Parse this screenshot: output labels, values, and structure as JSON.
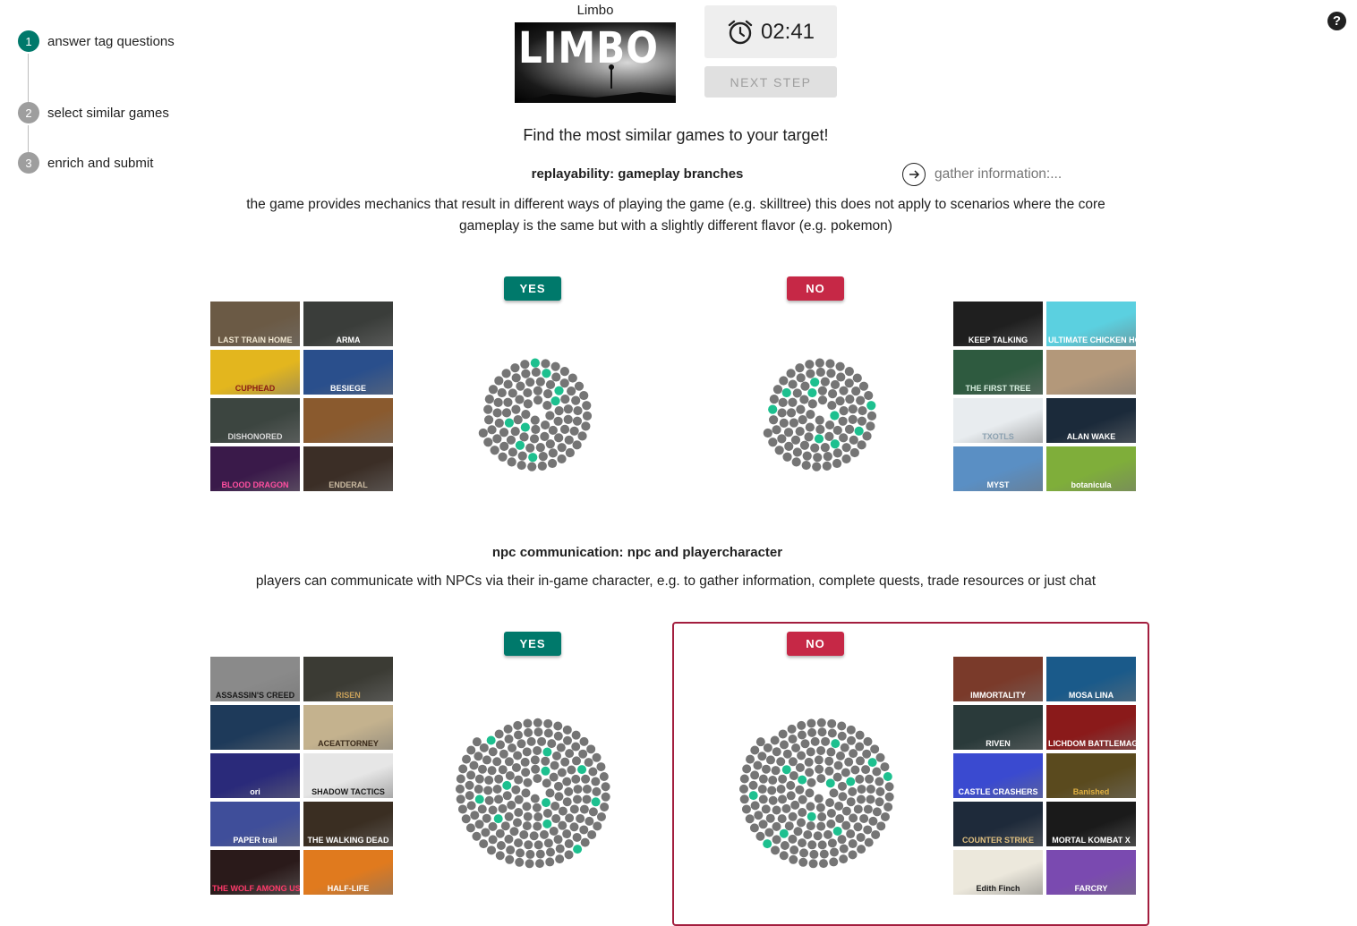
{
  "stepper": {
    "steps": [
      {
        "number": "1",
        "label": "answer tag questions"
      },
      {
        "number": "2",
        "label": "select similar games"
      },
      {
        "number": "3",
        "label": "enrich and submit"
      }
    ]
  },
  "help": {
    "icon": "question-icon",
    "glyph": "?"
  },
  "target": {
    "title": "Limbo",
    "cover_text": "LIMBO"
  },
  "timer": {
    "icon": "alarm-clock-icon",
    "value": "02:41"
  },
  "next_step": {
    "label": "NEXT STEP"
  },
  "headline": "Find the most similar games to your target!",
  "gather": {
    "icon": "arrow-right-circle-icon",
    "placeholder": "gather information:..."
  },
  "colors": {
    "yes": "#00796b",
    "no": "#c62846",
    "dot": "#757575",
    "dot_highlight": "#1dc08f"
  },
  "questions": [
    {
      "title": "replayability: gameplay branches",
      "description": "the game provides mechanics that result in different ways of playing the game (e.g. skilltree) this does not apply to scenarios where the core gameplay is the same but with a slightly different flavor (e.g. pokemon)",
      "yes_label": "YES",
      "no_label": "NO",
      "selected": "",
      "yes_games": [
        {
          "label": "LAST TRAIN HOME",
          "bg": "#6b5a45",
          "fg": "#f0e6d0"
        },
        {
          "label": "ARMA",
          "bg": "#3a3d3a",
          "fg": "#ffffff"
        },
        {
          "label": "CUPHEAD",
          "bg": "#e3b61e",
          "fg": "#8b1b12"
        },
        {
          "label": "BESIEGE",
          "bg": "#2a4f8c",
          "fg": "#ffffff"
        },
        {
          "label": "DISHONORED",
          "bg": "#3c4540",
          "fg": "#d8d8d8"
        },
        {
          "label": "",
          "bg": "#8a5a2e",
          "fg": "#ffffff"
        },
        {
          "label": "BLOOD DRAGON",
          "bg": "#3a1a4a",
          "fg": "#ff4fa0"
        },
        {
          "label": "ENDERAL",
          "bg": "#3b2e26",
          "fg": "#c9b9a0"
        }
      ],
      "no_games": [
        {
          "label": "KEEP TALKING",
          "bg": "#1f1f1f",
          "fg": "#ffffff"
        },
        {
          "label": "ULTIMATE CHICKEN HORSE",
          "bg": "#5bd0e0",
          "fg": "#ffffff"
        },
        {
          "label": "THE FIRST TREE",
          "bg": "#2e5a3f",
          "fg": "#d8efe0"
        },
        {
          "label": "",
          "bg": "#b3987a",
          "fg": "#3a2a1a"
        },
        {
          "label": "TXOTLS",
          "bg": "#e8ecef",
          "fg": "#8aa0b0"
        },
        {
          "label": "ALAN WAKE",
          "bg": "#1b2a3a",
          "fg": "#ffffff"
        },
        {
          "label": "MYST",
          "bg": "#5a8fc4",
          "fg": "#ffffff"
        },
        {
          "label": "botanicula",
          "bg": "#7fae3a",
          "fg": "#ffffff"
        }
      ],
      "yes_spiral": {
        "dots": 100,
        "highlights": [
          8,
          15,
          23,
          31,
          40,
          51,
          63,
          77
        ]
      },
      "no_spiral": {
        "dots": 100,
        "highlights": [
          5,
          12,
          20,
          28,
          37,
          46,
          58,
          70,
          84
        ]
      }
    },
    {
      "title": "npc communication: npc and playercharacter",
      "description": "players can communicate with NPCs via their in-game character, e.g. to gather information, complete quests, trade resources or just chat",
      "yes_label": "YES",
      "no_label": "NO",
      "selected": "no",
      "yes_games": [
        {
          "label": "ASSASSIN'S CREED",
          "bg": "#8a8a8a",
          "fg": "#1a1a1a"
        },
        {
          "label": "RISEN",
          "bg": "#3b3b34",
          "fg": "#c9a15a"
        },
        {
          "label": "",
          "bg": "#1e3a5a",
          "fg": "#ff8040"
        },
        {
          "label": "ACEATTORNEY",
          "bg": "#c4b28e",
          "fg": "#3a2a1a"
        },
        {
          "label": "ori",
          "bg": "#2a2a7a",
          "fg": "#ffffff"
        },
        {
          "label": "SHADOW TACTICS",
          "bg": "#e6e6e6",
          "fg": "#1a1a1a"
        },
        {
          "label": "PAPER trail",
          "bg": "#3f4e9a",
          "fg": "#ffffff"
        },
        {
          "label": "THE WALKING DEAD",
          "bg": "#3a2e22",
          "fg": "#ffffff"
        },
        {
          "label": "THE WOLF AMONG US",
          "bg": "#2a1a1a",
          "fg": "#ff3a6a"
        },
        {
          "label": "HALF-LIFE",
          "bg": "#e07a1e",
          "fg": "#ffffff"
        }
      ],
      "no_games": [
        {
          "label": "IMMORTALITY",
          "bg": "#7a3a2a",
          "fg": "#ffffff"
        },
        {
          "label": "MOSA LINA",
          "bg": "#1a5a8a",
          "fg": "#ffffff"
        },
        {
          "label": "RIVEN",
          "bg": "#2a3a3a",
          "fg": "#ffffff"
        },
        {
          "label": "LICHDOM BATTLEMAGE",
          "bg": "#8a1a1a",
          "fg": "#ffffff"
        },
        {
          "label": "CASTLE CRASHERS",
          "bg": "#3a4ad0",
          "fg": "#ffffff"
        },
        {
          "label": "Banished",
          "bg": "#5a4a1e",
          "fg": "#e0b040"
        },
        {
          "label": "COUNTER STRIKE",
          "bg": "#1e2a3a",
          "fg": "#e0c080"
        },
        {
          "label": "MORTAL KOMBAT X",
          "bg": "#1a1a1a",
          "fg": "#ffffff"
        },
        {
          "label": "Edith Finch",
          "bg": "#ece8dc",
          "fg": "#1a1a1a"
        },
        {
          "label": "FARCRY",
          "bg": "#7a4ab0",
          "fg": "#ffffff"
        }
      ],
      "yes_spiral": {
        "dots": 190,
        "highlights": [
          6,
          14,
          25,
          38,
          52,
          68,
          84,
          102,
          122,
          146,
          168
        ]
      },
      "no_spiral": {
        "dots": 190,
        "highlights": [
          4,
          11,
          21,
          33,
          47,
          62,
          80,
          98,
          118,
          140,
          160,
          178
        ]
      }
    }
  ]
}
